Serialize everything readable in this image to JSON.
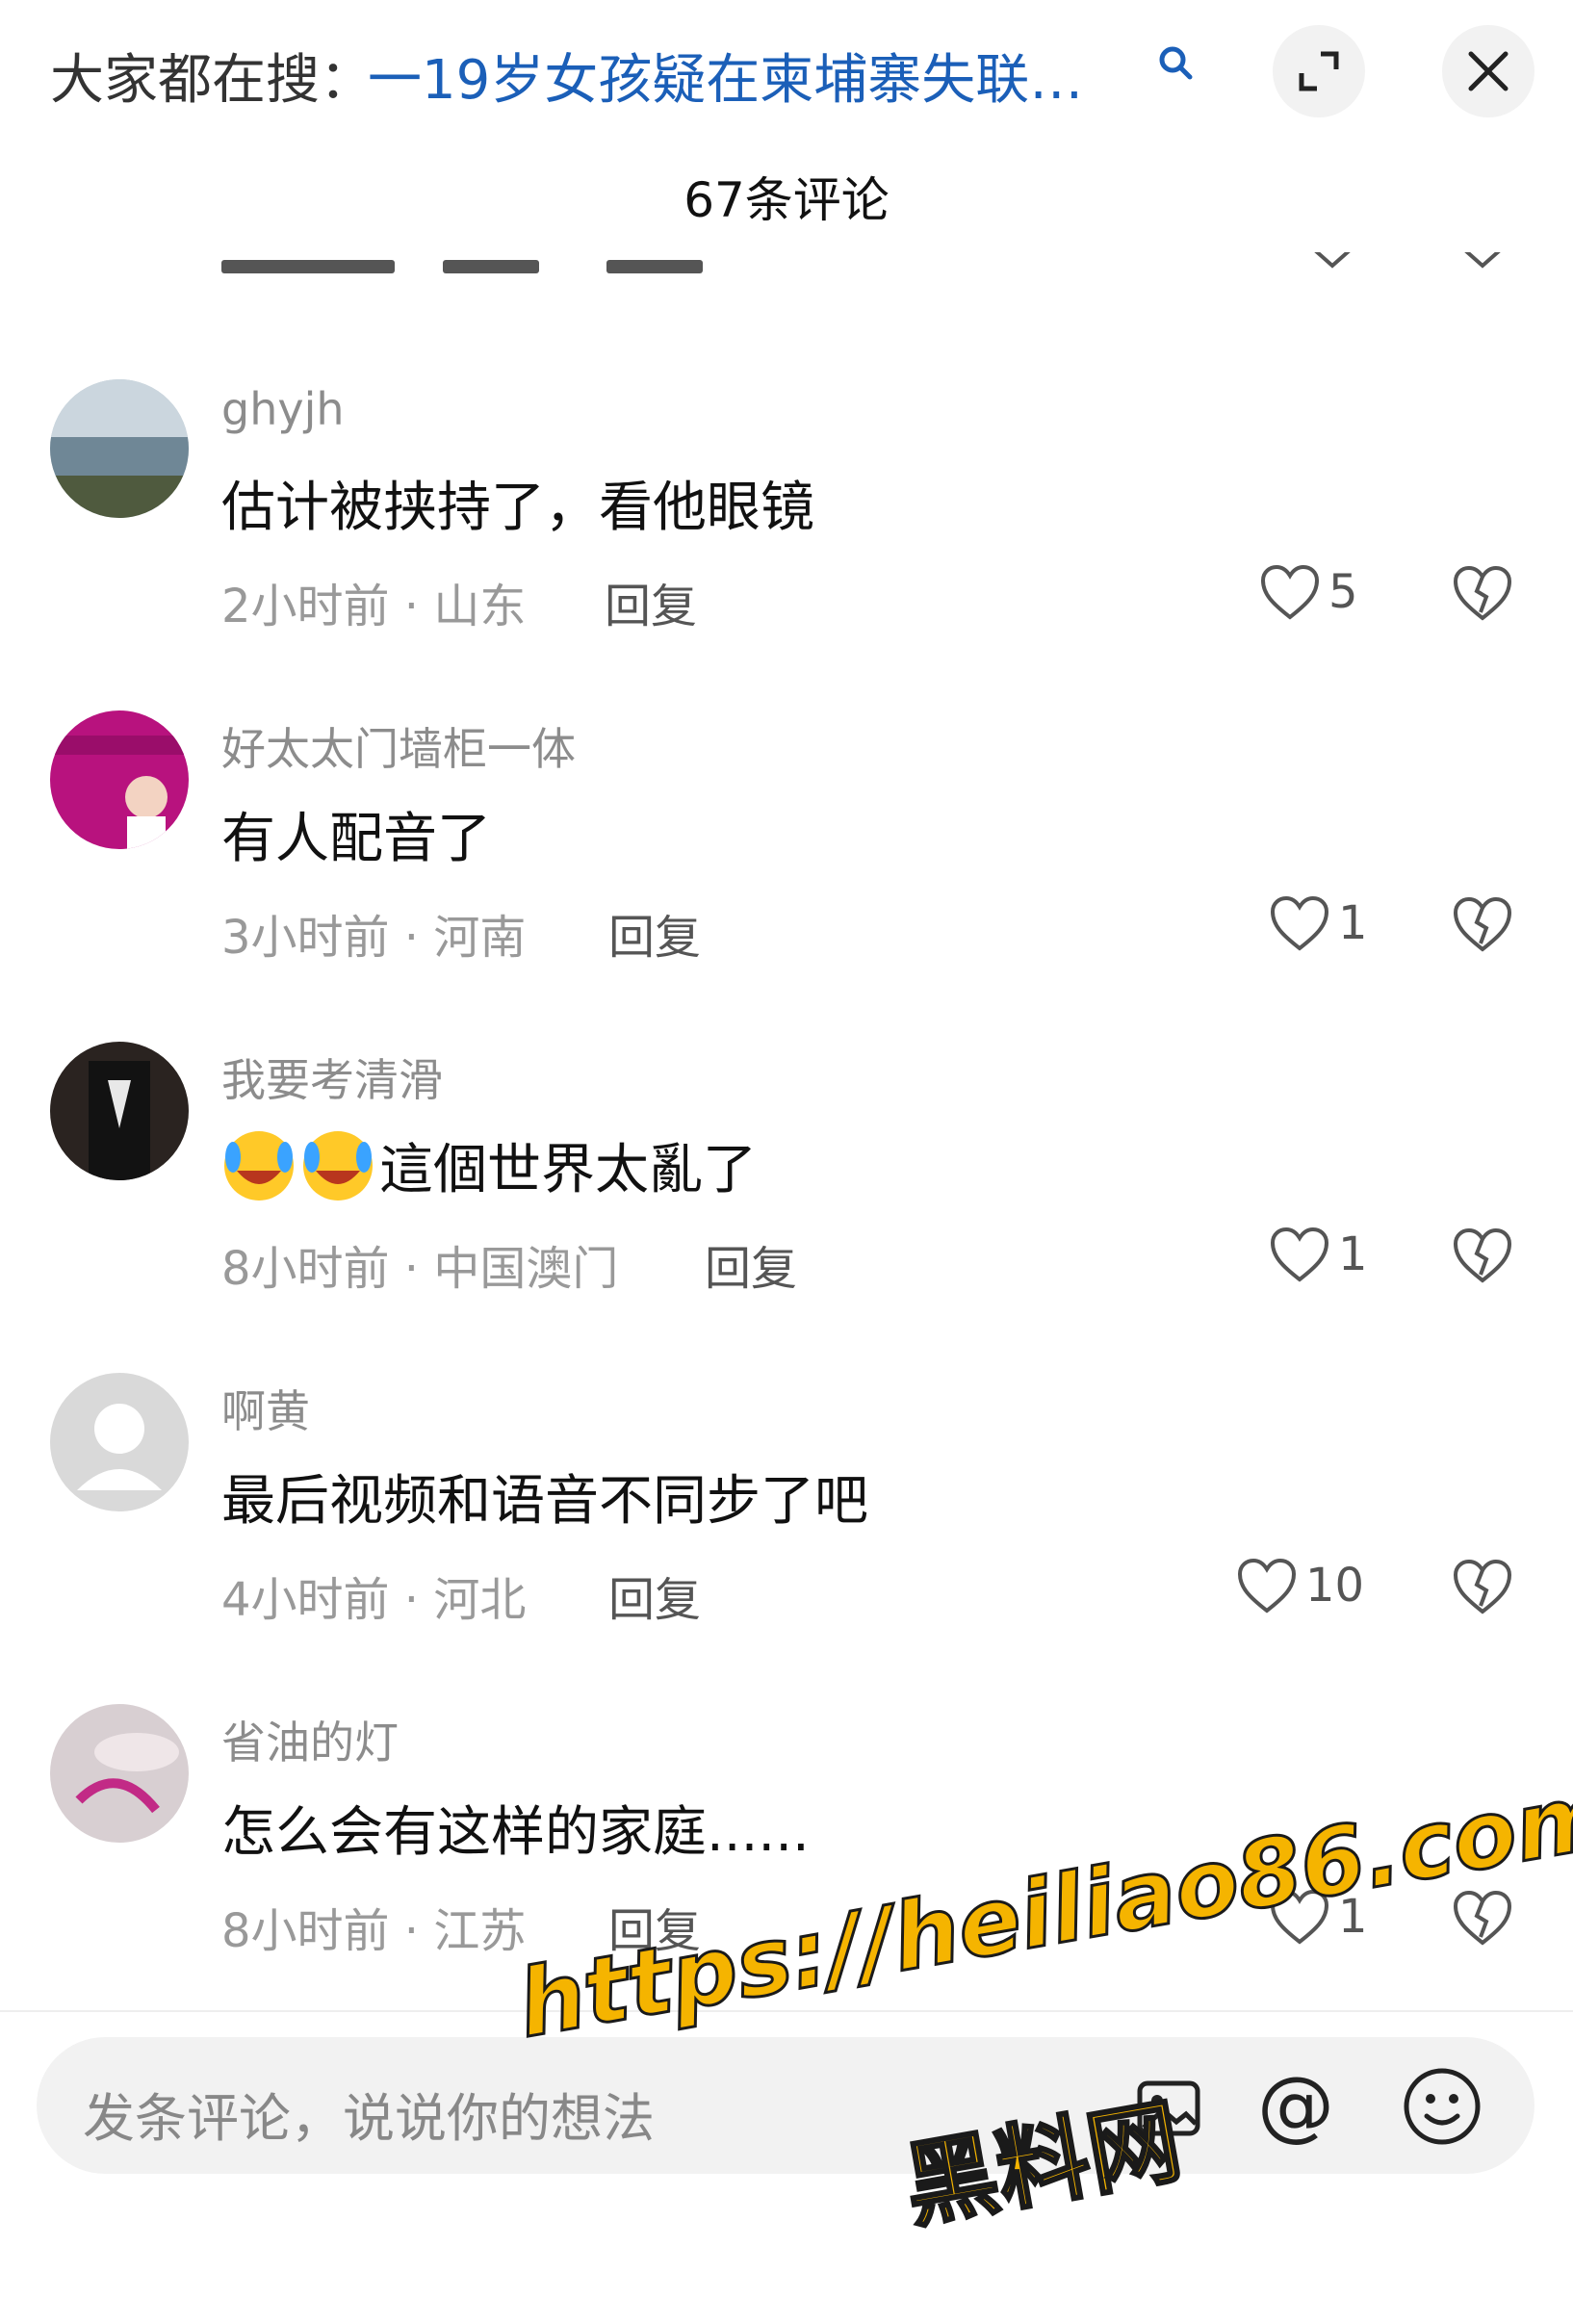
{
  "header": {
    "search_prefix": "大家都在搜：",
    "search_query": "一19岁女孩疑在柬埔寨失联…",
    "icons": [
      "search-icon",
      "expand-icon",
      "close-icon"
    ]
  },
  "comments_title": "67条评论",
  "comments": [
    {
      "username": "ghyjh",
      "content": "估计被挟持了，看他眼镜",
      "time": "2小时前 · 山东",
      "reply": "回复",
      "likes": "5"
    },
    {
      "username": "好太太门墙柜一体",
      "content": "有人配音了",
      "time": "3小时前 · 河南",
      "reply": "回复",
      "likes": "1"
    },
    {
      "username": "我要考清滑",
      "content": "這個世界太亂了",
      "time": "8小时前 · 中国澳门",
      "reply": "回复",
      "likes": "1"
    },
    {
      "username": "啊黄",
      "content": "最后视频和语音不同步了吧",
      "time": "4小时前 · 河北",
      "reply": "回复",
      "likes": "10"
    },
    {
      "username": "省油的灯",
      "content": "怎么会有这样的家庭......",
      "time": "8小时前 · 江苏",
      "reply": "回复",
      "likes": "1"
    }
  ],
  "input": {
    "placeholder": "发条评论，说说你的想法"
  },
  "watermark": {
    "url": "https://heiliao86.com",
    "name": "黑料网"
  },
  "colors": {
    "link_blue": "#1b5fb8",
    "watermark_yellow": "#f5b400"
  }
}
